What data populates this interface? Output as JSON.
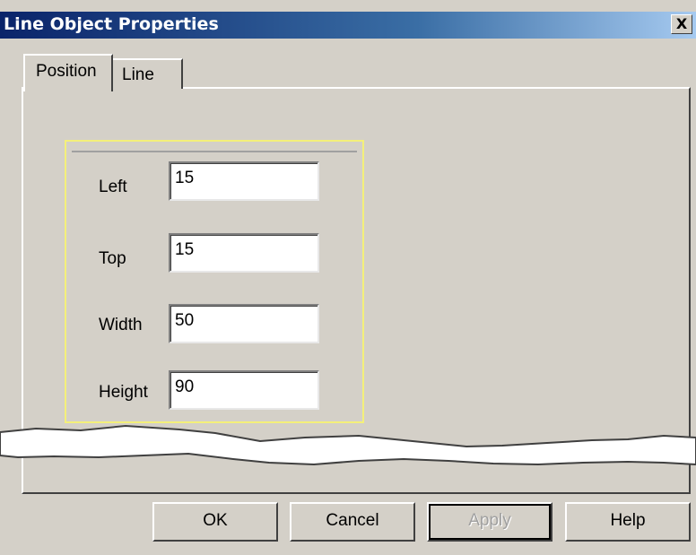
{
  "window": {
    "title": "Line Object Properties",
    "close_label": "X"
  },
  "tabs": [
    {
      "label": "Position",
      "selected": true
    },
    {
      "label": "Line",
      "selected": false
    }
  ],
  "fields": {
    "left": {
      "label": "Left",
      "value": "15"
    },
    "top": {
      "label": "Top",
      "value": "15"
    },
    "width": {
      "label": "Width",
      "value": "50"
    },
    "height": {
      "label": "Height",
      "value": "90"
    }
  },
  "buttons": {
    "ok": {
      "label": "OK"
    },
    "cancel": {
      "label": "Cancel"
    },
    "apply": {
      "label": "Apply",
      "enabled": false
    },
    "help": {
      "label": "Help"
    }
  },
  "colors": {
    "titlebar_start": "#0a246a",
    "titlebar_end": "#a6caf0",
    "dialog_face": "#d4d0c8",
    "groupbox_highlight": "#f4f07a"
  }
}
